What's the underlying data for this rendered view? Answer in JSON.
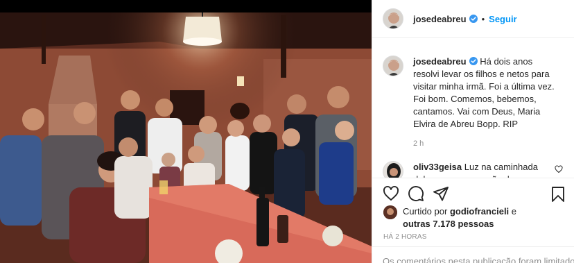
{
  "post": {
    "username": "josedeabreu",
    "follow_label": "Seguir",
    "separator": "•"
  },
  "caption": {
    "username": "josedeabreu",
    "text": "Há dois anos resolvi levar os filhos e netos para visitar minha irmã. Foi a última vez. Foi bom. Comemos, bebemos, cantamos. Vai com Deus, Maria Elvira de Abreu Bopp. RIP",
    "time": "2 h"
  },
  "comment": {
    "username": "oliv33geisa",
    "text": "Luz na caminhada dela e paz no coração dos que"
  },
  "likes": {
    "prefix": "Curtido por",
    "user": "godiofrancieli",
    "conj": "e",
    "others": "outras 7.178 pessoas"
  },
  "time_ago": "HÁ 2 HORAS",
  "comments_off": "Os comentários nesta publicação foram limitados",
  "colors": {
    "follow": "#0095f6",
    "verified": "#3897f0",
    "muted": "#8e8e8e"
  },
  "icons": [
    "verified-icon",
    "heart-icon",
    "comment-icon",
    "share-icon",
    "bookmark-icon"
  ]
}
